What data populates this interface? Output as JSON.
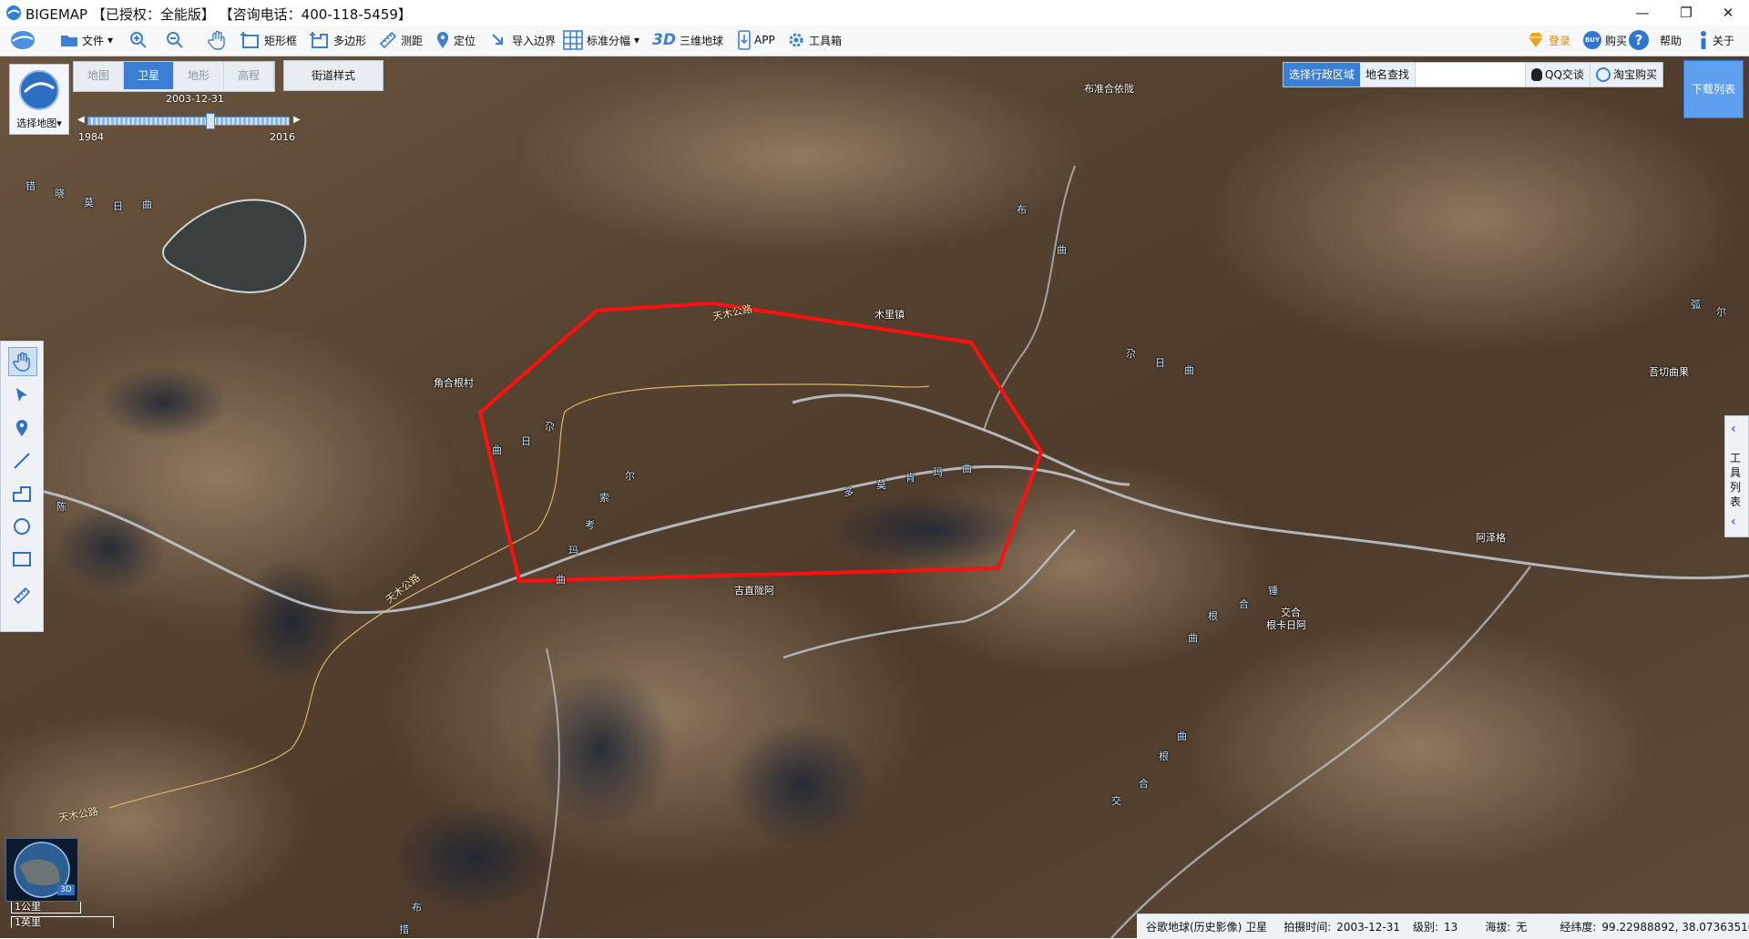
{
  "titlebar": {
    "app_name": "BIGEMAP",
    "license": "【已授权：全能版】",
    "hotline": "【咨询电话：400-118-5459】",
    "minimize": "—",
    "restore": "❐",
    "close": "✕"
  },
  "toolbar": {
    "file": "文件",
    "rect": "矩形框",
    "polygon": "多边形",
    "measure": "测距",
    "locate": "定位",
    "import_border": "导入边界",
    "standard_grid": "标准分幅",
    "d3": "3D",
    "globe3d": "三维地球",
    "app": "APP",
    "toolbox": "工具箱",
    "login": "登录",
    "buy": "购买",
    "buy_badge": "BUY",
    "help": "帮助",
    "about": "关于"
  },
  "map_select": {
    "label": "选择地图"
  },
  "map_tabs": [
    {
      "label": "地图",
      "active": false
    },
    {
      "label": "卫星",
      "active": true
    },
    {
      "label": "地形",
      "active": false
    },
    {
      "label": "高程",
      "active": false
    }
  ],
  "street_style": "街道样式",
  "timeline": {
    "current": "2003-12-31",
    "start": "1984",
    "end": "2016",
    "position_fraction": 0.61
  },
  "right_panel": {
    "admin_region": "选择行政区域",
    "place_search": "地名查找",
    "qq": "QQ交谈",
    "taobao": "淘宝购买",
    "download_list": "下载列表",
    "tool_list": [
      "工",
      "具",
      "列",
      "表"
    ]
  },
  "map_labels": {
    "places": [
      "布准合依陇",
      "木里镇",
      "角合根村",
      "吉直陇阿",
      "阿泽格",
      "交合",
      "根卡日阿",
      "吾切曲果"
    ],
    "roads": [
      "天木公路",
      "天木公路",
      "天木公路"
    ],
    "rivers": [
      "错",
      "晓",
      "莫",
      "日",
      "曲",
      "布",
      "曲",
      "尕",
      "日",
      "曲",
      "多",
      "莫",
      "肯",
      "玛",
      "曲",
      "尕",
      "日",
      "曲",
      "索",
      "尔",
      "陈",
      "考",
      "玛",
      "曲",
      "根",
      "曲",
      "合",
      "锤",
      "交",
      "合",
      "根",
      "曲",
      "布",
      "措",
      "弧",
      "尔"
    ]
  },
  "scale": {
    "km": "1公里",
    "mi": "1英里"
  },
  "globe_badge": "3D",
  "status": {
    "source": "谷歌地球(历史影像) 卫星",
    "capture_label": "拍摄时间:",
    "capture_date": "2003-12-31",
    "level_label": "级别:",
    "level": "13",
    "altitude_label": "海拔:",
    "altitude": "无",
    "coord_label": "经纬度:",
    "coords": "99.22988892, 38.07363510"
  },
  "colors": {
    "accent": "#3a7fd6",
    "polygon": "#ff1010",
    "download": "#5f9ff0"
  }
}
